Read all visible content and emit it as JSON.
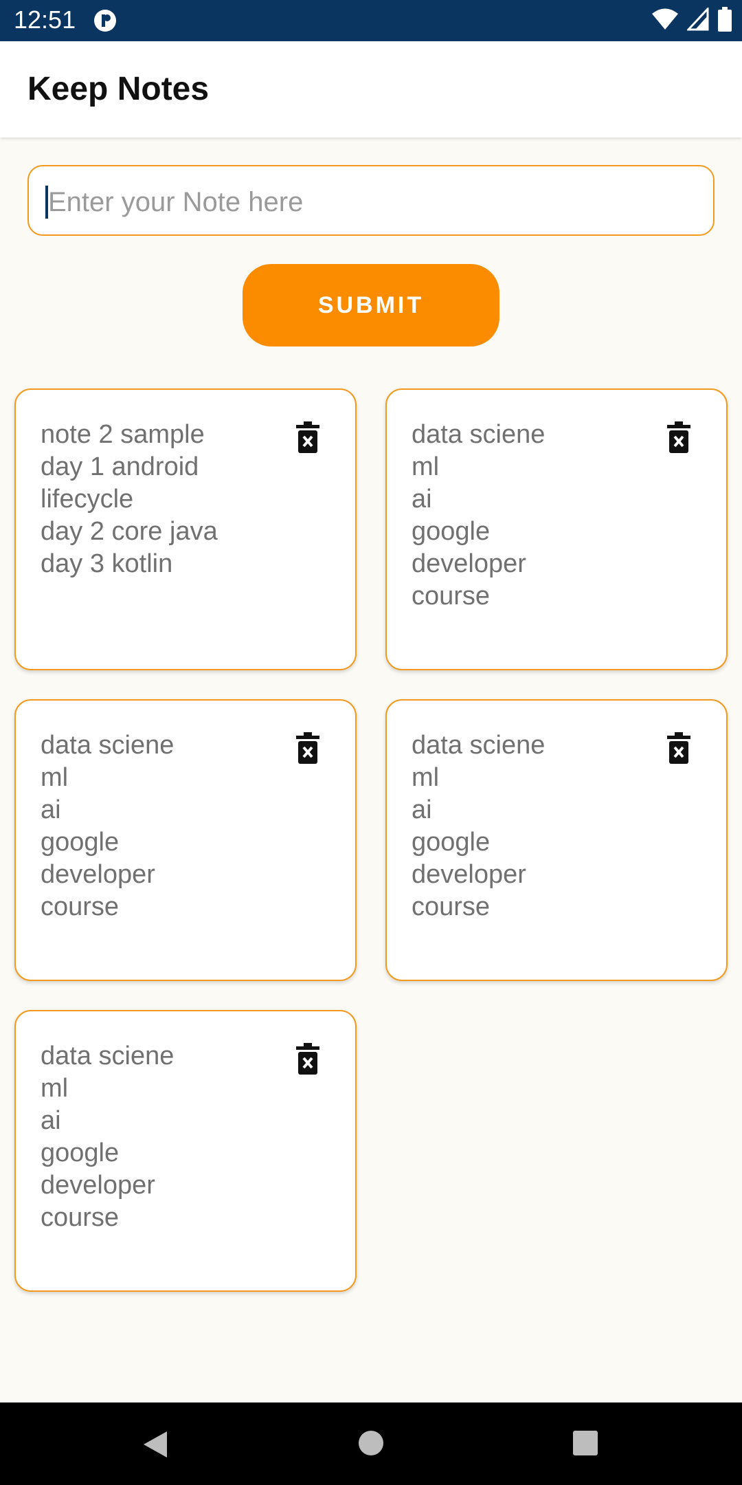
{
  "status": {
    "time": "12:51"
  },
  "app": {
    "title": "Keep Notes"
  },
  "input": {
    "placeholder": "Enter your Note here"
  },
  "submit": {
    "label": "SUBMIT"
  },
  "notes": [
    {
      "text": "note  2 sample\nday 1 android\nlifecycle\nday 2 core java\nday 3 kotlin"
    },
    {
      "text": "data sciene\nml\nai\ngoogle\ndeveloper\ncourse"
    },
    {
      "text": "data sciene\nml\nai\ngoogle\ndeveloper\ncourse"
    },
    {
      "text": "data sciene\nml\nai\ngoogle\ndeveloper\ncourse"
    },
    {
      "text": "data sciene\nml\nai\ngoogle\ndeveloper\ncourse"
    }
  ],
  "icons": {
    "note_action": "delete-icon",
    "nav": [
      "back-icon",
      "home-icon",
      "recents-icon"
    ]
  },
  "colors": {
    "accent": "#fb8c00",
    "status_bar": "#0a3561",
    "card_border": "#f29a1d"
  }
}
